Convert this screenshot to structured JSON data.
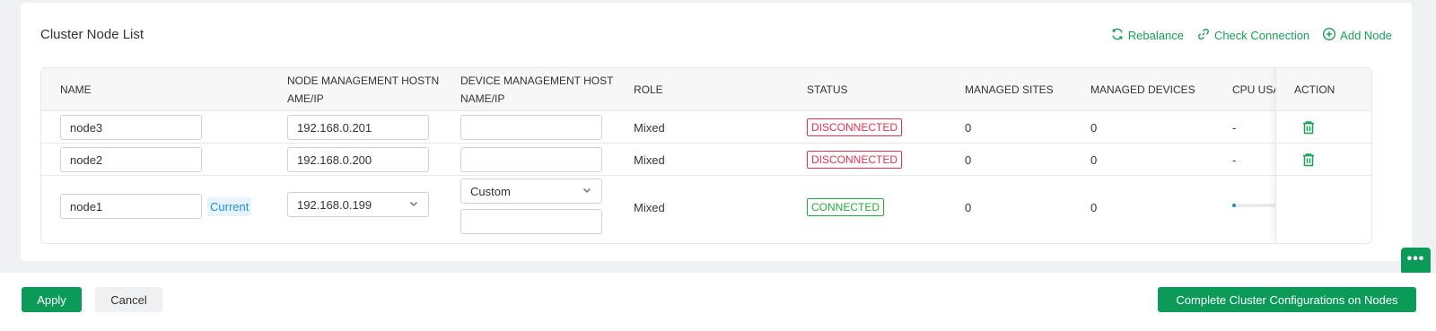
{
  "card": {
    "title": "Cluster Node List",
    "actions": {
      "rebalance": "Rebalance",
      "check_connection": "Check Connection",
      "add_node": "Add Node"
    }
  },
  "table": {
    "headers": {
      "name": "NAME",
      "node_mgmt_line1": "NODE MANAGEMENT HOSTN",
      "node_mgmt_line2": "AME/IP",
      "device_mgmt_line1": "DEVICE MANAGEMENT HOST",
      "device_mgmt_line2": "NAME/IP",
      "role": "ROLE",
      "status": "STATUS",
      "managed_sites": "MANAGED SITES",
      "managed_devices": "MANAGED DEVICES",
      "cpu_usage": "CPU USA",
      "action": "ACTION"
    },
    "rows": [
      {
        "name": "node3",
        "node_ip": "192.168.0.201",
        "device_ip": "",
        "role": "Mixed",
        "status": "DISCONNECTED",
        "managed_sites": "0",
        "managed_devices": "0",
        "cpu": "-"
      },
      {
        "name": "node2",
        "node_ip": "192.168.0.200",
        "device_ip": "",
        "role": "Mixed",
        "status": "DISCONNECTED",
        "managed_sites": "0",
        "managed_devices": "0",
        "cpu": "-"
      },
      {
        "name": "node1",
        "current_tag": "Current",
        "node_ip": "192.168.0.199",
        "device_mode": "Custom",
        "device_ip": "",
        "role": "Mixed",
        "status": "CONNECTED",
        "managed_sites": "0",
        "managed_devices": "0",
        "cpu_fraction": 0.05
      }
    ]
  },
  "footer": {
    "apply": "Apply",
    "cancel": "Cancel",
    "complete": "Complete Cluster Configurations on Nodes"
  },
  "chat_fab": {
    "glyph": "•••"
  },
  "colors": {
    "accent": "#0b9a58",
    "link": "#18a058",
    "disconnected": "#e8314f",
    "connected": "#22b03d",
    "current_tag": "#1c8ed8"
  }
}
